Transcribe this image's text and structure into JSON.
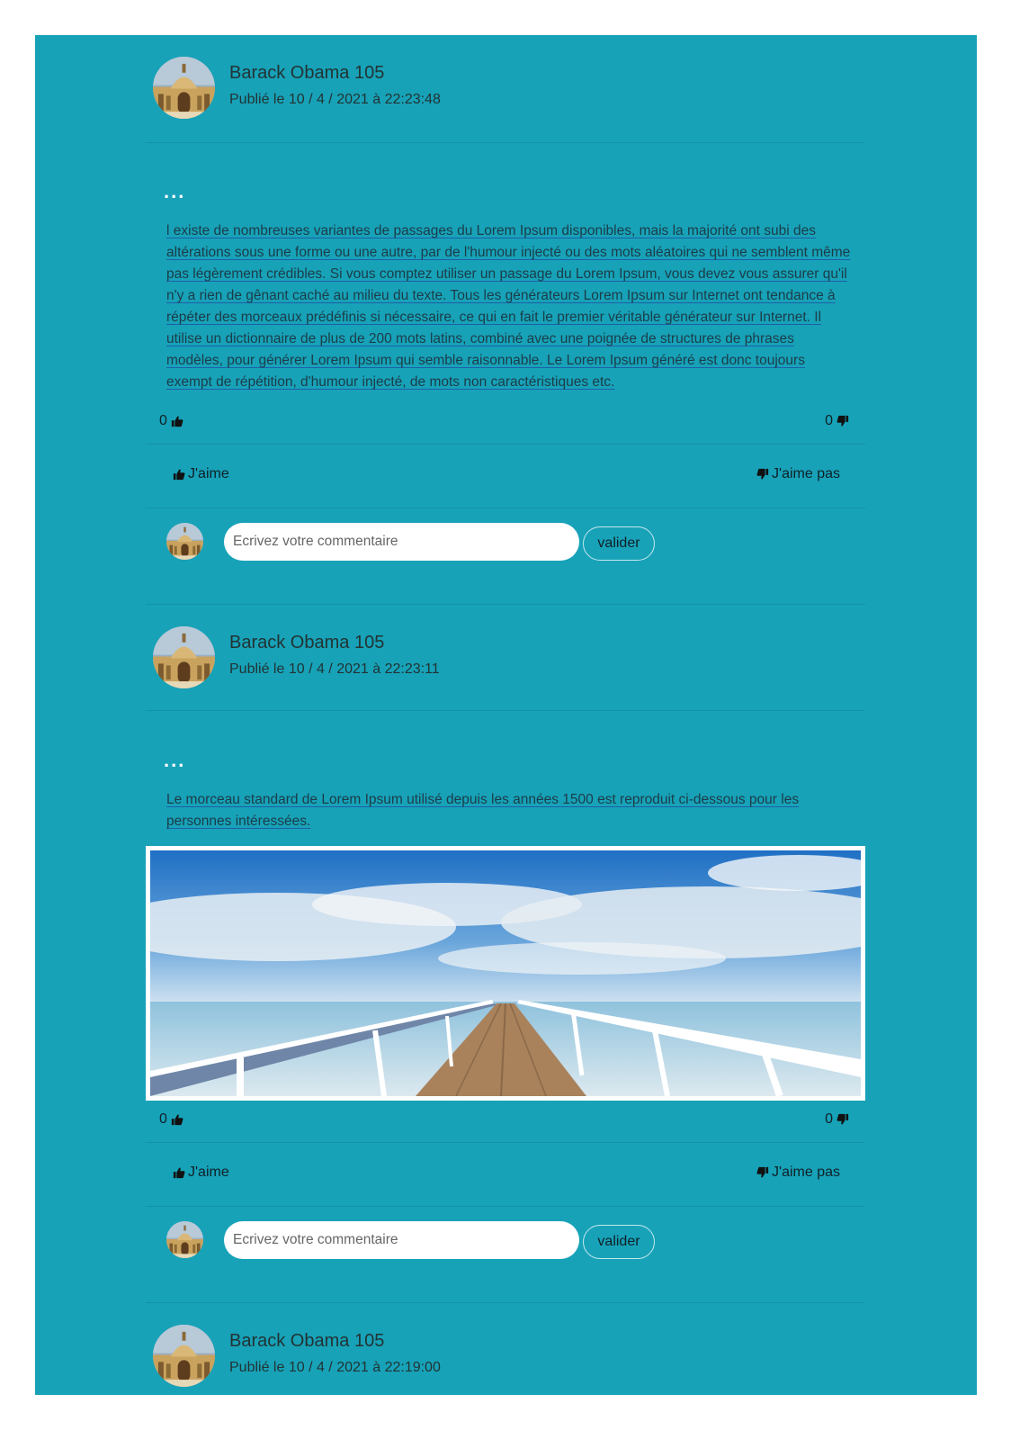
{
  "posts": [
    {
      "author": "Barack Obama 105",
      "date": "Publié le 10 / 4 / 2021 à 22:23:48",
      "text": "l existe de nombreuses variantes de passages du Lorem Ipsum disponibles, mais la majorité ont subi des altérations sous une forme ou une autre, par de l'humour injecté ou des mots aléatoires qui ne semblent même pas légèrement crédibles. Si vous comptez utiliser un passage du Lorem Ipsum, vous devez vous assurer qu'il n'y a rien de gênant caché au milieu du texte. Tous les générateurs Lorem Ipsum sur Internet ont tendance à répéter des morceaux prédéfinis si nécessaire, ce qui en fait le premier véritable générateur sur Internet. Il utilise un dictionnaire de plus de 200 mots latins, combiné avec une poignée de structures de phrases modèles, pour générer Lorem Ipsum qui semble raisonnable. Le Lorem Ipsum généré est donc toujours exempt de répétition, d'humour injecté, de mots non caractéristiques etc.",
      "menu": "...",
      "likes": "0",
      "dislikes": "0",
      "has_image": false
    },
    {
      "author": "Barack Obama 105",
      "date": "Publié le 10 / 4 / 2021 à 22:23:11",
      "text": "Le morceau standard de Lorem Ipsum utilisé depuis les années 1500 est reproduit ci-dessous pour les personnes intéressées.",
      "menu": "...",
      "likes": "0",
      "dislikes": "0",
      "has_image": true,
      "image_subject": "wooden pier over calm sea under blue sky with clouds"
    },
    {
      "author": "Barack Obama 105",
      "date": "Publié le 10 / 4 / 2021 à 22:19:00"
    }
  ],
  "ui": {
    "like_label": "J'aime",
    "dislike_label": "J'aime pas",
    "comment_placeholder": "Ecrivez votre commentaire",
    "submit_label": "valider"
  },
  "icons": {
    "thumb_up": "thumbs-up-icon",
    "thumb_down": "thumbs-down-icon",
    "avatar": "palace-avatar"
  },
  "colors": {
    "feed_background": "#17a2b8",
    "page_background": "#ffffff",
    "text": "#1c3c48",
    "underline": "#1e5fa8"
  }
}
